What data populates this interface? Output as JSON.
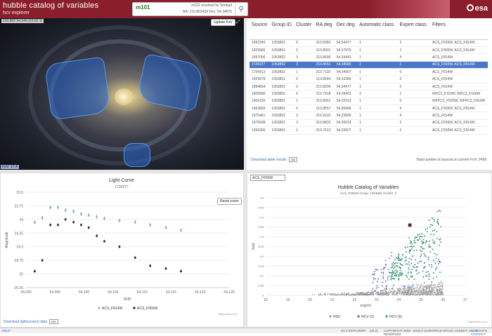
{
  "header": {
    "title": "hubble catalog of variables",
    "subtitle": "hcv explorer",
    "search_value": "m101",
    "resolved": "m101 resolved by Simbad",
    "coords": "RA: 210.802429 Dec: 54.34875",
    "logo": "esa"
  },
  "sky": {
    "caption": "210.802 54.349 (03:02:1)",
    "update_button": "Update FoV",
    "fov": "FoV: 17.4'"
  },
  "table": {
    "columns": [
      "Source",
      "Group ID",
      "Cluster",
      "RA deg",
      "Dec deg",
      "Automatic class.",
      "Expert class.",
      "Filters"
    ],
    "rows": [
      [
        "1493249",
        "1053852",
        "0",
        "210.8382",
        "54.34477",
        "1",
        "2",
        "ACS_F555W, ACS_F814W"
      ],
      [
        "1829965",
        "1053852",
        "0",
        "210.8901",
        "54.37879",
        "1",
        "1",
        "ACS_F555W, ACS_F814W"
      ],
      [
        "1697056",
        "1053852",
        "3",
        "210.8690",
        "54.34442",
        "1",
        "4",
        "ACS_F814W"
      ],
      [
        "1726377",
        "1053852",
        "3",
        "210.8651",
        "54.38686",
        "2",
        "1",
        "ACS_F555W, ACS_F814W"
      ],
      [
        "1754913",
        "1053852",
        "1",
        "210.7118",
        "54.34907",
        "1",
        "0",
        "ACS_F814W"
      ],
      [
        "1829978",
        "1053852",
        "0",
        "210.8544",
        "54.33396",
        "1",
        "2",
        "ACS_F814W"
      ],
      [
        "1894664",
        "1053852",
        "0",
        "210.8204",
        "54.34477",
        "1",
        "2",
        "ACS_F814W"
      ],
      [
        "1909990",
        "1053852",
        "0",
        "210.7918",
        "54.28422",
        "2",
        "1",
        "WFC3_F110W, WFC3_F160W"
      ],
      [
        "1904192",
        "1053852",
        "1",
        "210.8061",
        "54.32013",
        "1",
        "0",
        "WFPC2_F555W, WFPC2_F814W"
      ],
      [
        "1963893",
        "1053852",
        "0",
        "210.8557",
        "54.38468",
        "1",
        "4",
        "ACS_F555W, ACS_F814W"
      ],
      [
        "1975461",
        "1053852",
        "3",
        "210.9118",
        "54.33900",
        "1",
        "4",
        "ACS_F814W"
      ],
      [
        "1979938",
        "1053852",
        "3",
        "210.8833",
        "54.35624",
        "1",
        "2",
        "ACS_F555W, ACS_F814W"
      ],
      [
        "1993366",
        "1053852",
        "1",
        "210.7612",
        "54.33627",
        "1",
        "2",
        "ACS_F555W, ACS_F814W"
      ]
    ],
    "selected_index": 3,
    "download_label": "Download table results",
    "download_format": "csv",
    "total_text": "Total number of sources in current FoV: 2499"
  },
  "light_curve": {
    "reset_button": "Reset zoom",
    "credit": "Highcharts.com",
    "download_label": "Download lightcurve(s) data",
    "download_format": "csv"
  },
  "scatter_panel": {
    "filter_select": "ACS_F555W",
    "credit": "Highcharts.com"
  },
  "footer": {
    "help": "HELP",
    "explorer": "HCV EXPLORER",
    "version": "(v0.2)",
    "copyright": "COPYRIGHT 2008 - 2019 © EUROPEAN SPACE AGENCY. ALL RIGHTS RESERVED",
    "contact": "HCV CONTACT"
  },
  "chart_data": [
    {
      "type": "scatter",
      "title": "Light Curve",
      "subtitle": "1726377",
      "xlabel": "MJD",
      "ylabel": "Magnitude",
      "xlim": [
        54.09,
        54.125
      ],
      "ylim": [
        25.25,
        23.5
      ],
      "xticks": [
        "54.090",
        "54.095",
        "54.100",
        "54.105",
        "54.110",
        "54.115",
        "54.120",
        "54.125"
      ],
      "yticks": [
        "23.5",
        "23.75",
        "24",
        "24.25",
        "24.5",
        "24.75",
        "25",
        "25.25"
      ],
      "series": [
        {
          "name": "ACS_F814W",
          "color": "#7cb5ec",
          "x": [
            54.0915,
            54.0928,
            54.0942,
            54.0955,
            54.0968,
            54.0982,
            54.0995,
            54.1008,
            54.1022,
            54.1035,
            54.1061,
            54.1088,
            54.1114,
            54.1141,
            54.1167
          ],
          "y": [
            24.05,
            23.97,
            23.78,
            23.78,
            23.83,
            23.85,
            23.9,
            23.92,
            23.95,
            23.98,
            24.02,
            24.05,
            24.1,
            24.15,
            24.2
          ]
        },
        {
          "name": "ACS_F555W",
          "color": "#222222",
          "x": [
            54.0915,
            54.0928,
            54.0942,
            54.0955,
            54.0968,
            54.0982,
            54.0995,
            54.1008,
            54.1022,
            54.1035,
            54.1061,
            54.1088,
            54.1114,
            54.1141,
            54.1167
          ],
          "y": [
            24.95,
            24.75,
            24.1,
            24.1,
            24.0,
            24.05,
            24.1,
            24.15,
            24.3,
            24.4,
            24.5,
            24.7,
            24.85,
            24.9,
            24.95
          ]
        }
      ]
    },
    {
      "type": "scatter",
      "title": "Hubble Catalog of Variables",
      "subtitle": "ACS_F555W Group: 1053852 Cluster: 3",
      "xlabel": "avg(m)",
      "ylabel": "mad",
      "xlim": [
        18,
        27
      ],
      "ylim": [
        0,
        0.5
      ],
      "xticks": [
        "18",
        "19",
        "20",
        "21",
        "22",
        "23",
        "24",
        "25",
        "26",
        "27"
      ],
      "yticks": [
        "0",
        "0.05",
        "0.1",
        "0.15",
        "0.2",
        "0.25",
        "0.3",
        "0.35",
        "0.4",
        "0.45",
        "0.5"
      ],
      "legend": [
        "HSC",
        "HCV (1)",
        "HCV (h)"
      ],
      "colors": {
        "HSC": "#999999",
        "HCV (1)": "#4a6ac0",
        "HCV (h)": "#3aa06a",
        "selected": "#8a1f2b"
      },
      "selected_point": {
        "x": 24.5,
        "y": 0.36
      }
    }
  ]
}
